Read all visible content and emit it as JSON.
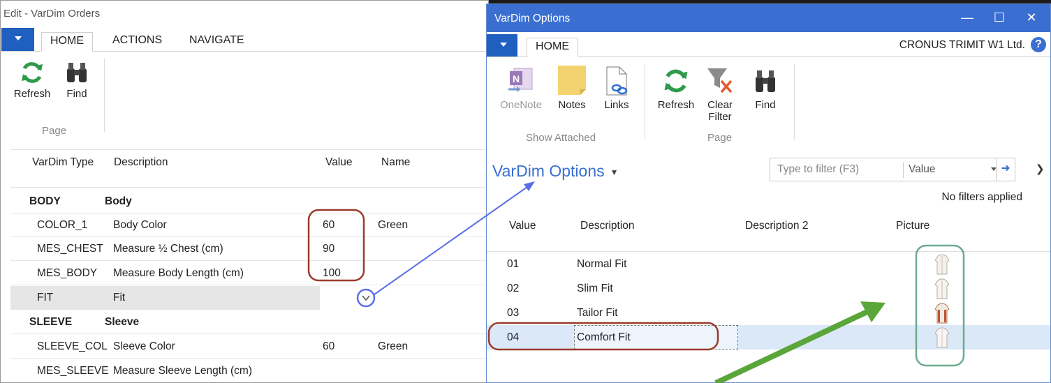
{
  "left_window": {
    "title": "Edit - VarDim Orders",
    "tabs": [
      "HOME",
      "ACTIONS",
      "NAVIGATE"
    ],
    "actions": {
      "refresh": "Refresh",
      "find": "Find"
    },
    "group_label": "Page",
    "columns": {
      "type": "VarDim Type",
      "description": "Description",
      "value": "Value",
      "name": "Name"
    },
    "rows": [
      {
        "type": "BODY",
        "description": "Body",
        "value": "",
        "name": "",
        "group": true
      },
      {
        "type": "COLOR_1",
        "description": "Body Color",
        "value": "60",
        "name": "Green"
      },
      {
        "type": "MES_CHEST",
        "description": "Measure ½ Chest (cm)",
        "value": "90",
        "name": ""
      },
      {
        "type": "MES_BODY",
        "description": "Measure Body Length (cm)",
        "value": "100",
        "name": ""
      },
      {
        "type": "FIT",
        "description": "Fit",
        "value": "",
        "name": "",
        "selected": true
      },
      {
        "type": "SLEEVE",
        "description": "Sleeve",
        "value": "",
        "name": "",
        "group": true
      },
      {
        "type": "SLEEVE_COL",
        "description": "Sleeve Color",
        "value": "60",
        "name": "Green"
      },
      {
        "type": "MES_SLEEVE",
        "description": "Measure Sleeve Length (cm)",
        "value": "",
        "name": ""
      }
    ]
  },
  "right_window": {
    "title": "VarDim Options",
    "tab": "HOME",
    "company": "CRONUS TRIMIT W1 Ltd.",
    "help": "?",
    "actions": {
      "onenote": "OneNote",
      "notes": "Notes",
      "links": "Links",
      "refresh": "Refresh",
      "clear_filter_1": "Clear",
      "clear_filter_2": "Filter",
      "find": "Find"
    },
    "group_labels": {
      "attached": "Show Attached",
      "page": "Page"
    },
    "page_title": "VarDim Options",
    "filter": {
      "placeholder": "Type to filter (F3)",
      "field": "Value"
    },
    "no_filters": "No filters applied",
    "columns": {
      "value": "Value",
      "description": "Description",
      "description2": "Description 2",
      "picture": "Picture"
    },
    "rows": [
      {
        "value": "01",
        "description": "Normal Fit"
      },
      {
        "value": "02",
        "description": "Slim Fit"
      },
      {
        "value": "03",
        "description": "Tailor Fit"
      },
      {
        "value": "04",
        "description": "Comfort Fit",
        "selected": true
      }
    ]
  },
  "colors": {
    "accent_blue": "#3a6fd1",
    "annotation_red": "#9a3b2a",
    "annotation_blue": "#5a6fe6",
    "annotation_teal": "#6aab8e",
    "annotation_green": "#5aa63a"
  }
}
